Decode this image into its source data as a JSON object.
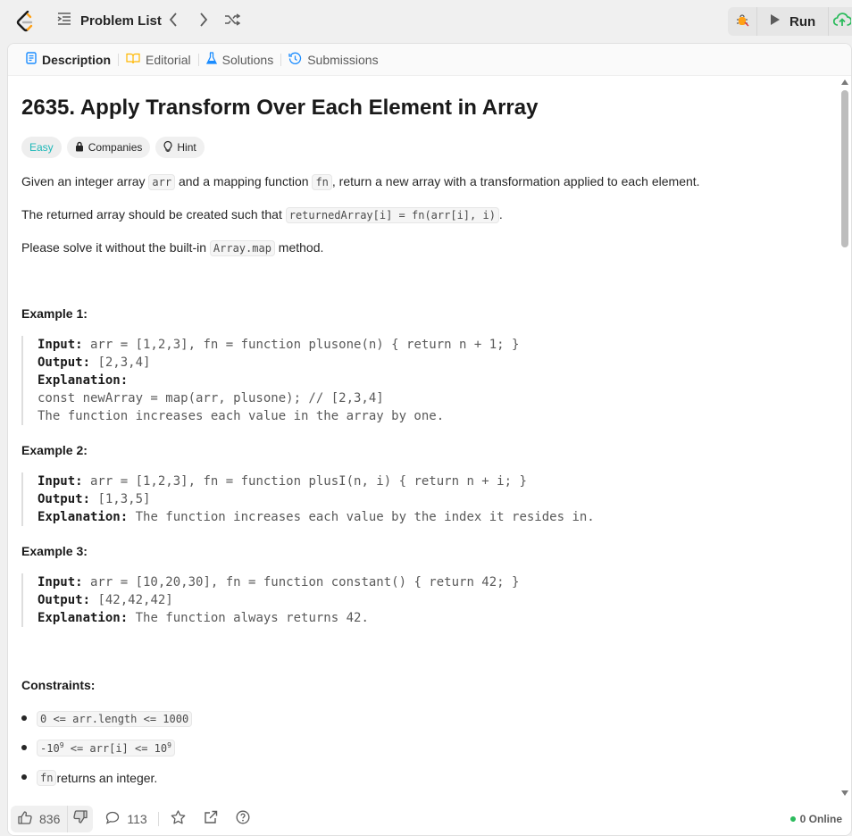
{
  "topbar": {
    "problem_list_label": "Problem List",
    "run_label": "Run"
  },
  "tabs": [
    {
      "label": "Description",
      "icon": "description-icon",
      "active": true
    },
    {
      "label": "Editorial",
      "icon": "book-icon",
      "active": false
    },
    {
      "label": "Solutions",
      "icon": "flask-icon",
      "active": false
    },
    {
      "label": "Submissions",
      "icon": "history-icon",
      "active": false
    }
  ],
  "problem": {
    "title": "2635. Apply Transform Over Each Element in Array",
    "difficulty": "Easy",
    "companies_label": "Companies",
    "hint_label": "Hint",
    "desc1": {
      "t1": "Given an integer array ",
      "c1": "arr",
      "t2": " and a mapping function ",
      "c2": "fn",
      "t3": ", return a new array with a transformation applied to each element."
    },
    "desc2": {
      "t1": "The returned array should be created such that ",
      "c1": "returnedArray[i] = fn(arr[i], i)",
      "t2": "."
    },
    "desc3": {
      "t1": "Please solve it without the built-in ",
      "c1": "Array.map",
      "t2": " method."
    }
  },
  "examples": [
    {
      "heading": "Example 1:",
      "input_label": "Input:",
      "input": " arr = [1,2,3], fn = function plusone(n) { return n + 1; }",
      "output_label": "Output:",
      "output": " [2,3,4]",
      "explanation_label": "Explanation:",
      "explanation_lines": [
        "const newArray = map(arr, plusone); // [2,3,4]",
        "The function increases each value in the array by one."
      ]
    },
    {
      "heading": "Example 2:",
      "input_label": "Input:",
      "input": " arr = [1,2,3], fn = function plusI(n, i) { return n + i; }",
      "output_label": "Output:",
      "output": " [1,3,5]",
      "explanation_label": "Explanation:",
      "explanation": " The function increases each value by the index it resides in."
    },
    {
      "heading": "Example 3:",
      "input_label": "Input:",
      "input": " arr = [10,20,30], fn = function constant() { return 42; }",
      "output_label": "Output:",
      "output": " [42,42,42]",
      "explanation_label": "Explanation:",
      "explanation": " The function always returns 42."
    }
  ],
  "constraints": {
    "heading": "Constraints:",
    "c1": "0 <= arr.length <= 1000",
    "c2_a": "-10",
    "c2_sup1": "9",
    "c2_b": " <= arr[i] <= 10",
    "c2_sup2": "9",
    "c3_code": "fn",
    "c3_text": " returns an integer."
  },
  "footer": {
    "likes": "836",
    "comments": "113",
    "online": "0 Online"
  },
  "colors": {
    "easy": "#1cb8b8",
    "online_dot": "#2cbb5d",
    "logo_orange": "#ffa116"
  }
}
